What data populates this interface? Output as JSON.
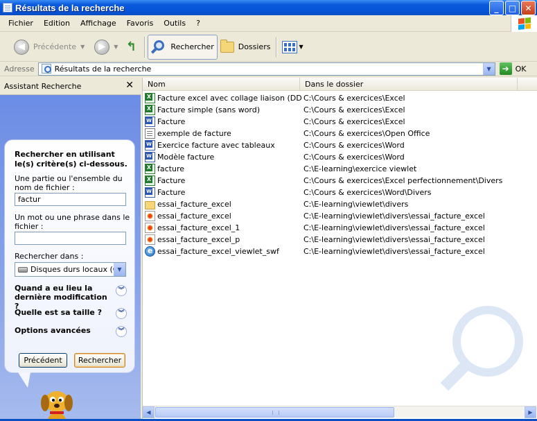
{
  "window": {
    "title": "Résultats de la recherche"
  },
  "window_buttons": [
    "_",
    "□",
    "✕"
  ],
  "menu": [
    "Fichier",
    "Edition",
    "Affichage",
    "Favoris",
    "Outils",
    "?"
  ],
  "toolbar": {
    "back_label": "Précédente",
    "search_label": "Rechercher",
    "folders_label": "Dossiers"
  },
  "address": {
    "label": "Adresse",
    "value": "Résultats de la recherche",
    "go_label": "OK"
  },
  "assistant": {
    "header": "Assistant Recherche",
    "close": "✕",
    "intro": "Rechercher en utilisant le(s) critère(s) ci-dessous.",
    "filename_label": "Une partie ou l'ensemble du nom de fichier :",
    "filename_value": "factur",
    "phrase_label": "Un mot ou une phrase dans le fichier :",
    "phrase_value": "",
    "lookin_label": "Rechercher dans :",
    "lookin_value": "Disques durs locaux (C:)",
    "section_modified": "Quand a eu lieu la dernière modification ?",
    "section_size": "Quelle est sa taille ?",
    "section_advanced": "Options avancées",
    "back_button": "Précédent",
    "search_button": "Rechercher"
  },
  "columns": {
    "name": "Nom",
    "folder": "Dans le dossier"
  },
  "files": [
    {
      "name": "Facture excel avec collage liaison (DDE)",
      "folder": "C:\\Cours & exercices\\Excel",
      "icon": "excel"
    },
    {
      "name": "Facture simple (sans word)",
      "folder": "C:\\Cours & exercices\\Excel",
      "icon": "excel"
    },
    {
      "name": "Facture",
      "folder": "C:\\Cours & exercices\\Excel",
      "icon": "word"
    },
    {
      "name": "exemple de facture",
      "folder": "C:\\Cours & exercices\\Open Office",
      "icon": "doc"
    },
    {
      "name": "Exercice facture avec tableaux",
      "folder": "C:\\Cours & exercices\\Word",
      "icon": "word"
    },
    {
      "name": "Modèle facture",
      "folder": "C:\\Cours & exercices\\Word",
      "icon": "word"
    },
    {
      "name": "facture",
      "folder": "C:\\E-learning\\exercice viewlet",
      "icon": "excel"
    },
    {
      "name": "Facture",
      "folder": "C:\\Cours & exercices\\Excel perfectionnement\\Divers",
      "icon": "excel"
    },
    {
      "name": "Facture",
      "folder": "C:\\Cours & exercices\\Word\\Divers",
      "icon": "word"
    },
    {
      "name": "essai_facture_excel",
      "folder": "C:\\E-learning\\viewlet\\divers",
      "icon": "folder"
    },
    {
      "name": "essai_facture_excel",
      "folder": "C:\\E-learning\\viewlet\\divers\\essai_facture_excel",
      "icon": "flash"
    },
    {
      "name": "essai_facture_excel_1",
      "folder": "C:\\E-learning\\viewlet\\divers\\essai_facture_excel",
      "icon": "flash"
    },
    {
      "name": "essai_facture_excel_p",
      "folder": "C:\\E-learning\\viewlet\\divers\\essai_facture_excel",
      "icon": "flash"
    },
    {
      "name": "essai_facture_excel_viewlet_swf",
      "folder": "C:\\E-learning\\viewlet\\divers\\essai_facture_excel",
      "icon": "ie"
    }
  ],
  "colors": {
    "titlebar": "#0653d8",
    "panel_blue": "#7a96df",
    "chrome": "#ece9d8"
  }
}
